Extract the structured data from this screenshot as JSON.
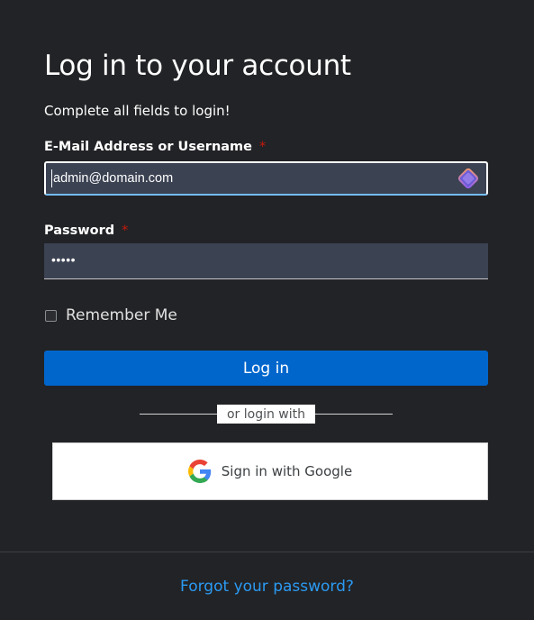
{
  "header": {
    "title": "Log in to your account",
    "subtitle": "Complete all fields to login!"
  },
  "form": {
    "email": {
      "label": "E-Mail Address or Username",
      "required_mark": "*",
      "value": "admin@domain.com"
    },
    "password": {
      "label": "Password",
      "required_mark": "*",
      "value_masked": "•••••"
    },
    "remember_me": {
      "label": "Remember Me",
      "checked": false
    },
    "submit_label": "Log in"
  },
  "social": {
    "divider_text": "or login with",
    "google_label": "Sign in with Google"
  },
  "footer": {
    "forgot_link": "Forgot your password?"
  },
  "colors": {
    "background": "#222326",
    "input_bg": "#3b4252",
    "primary": "#0066cc",
    "link": "#2b9af3",
    "required": "#c9190b"
  },
  "icons": {
    "password_manager": "password-manager-icon",
    "google": "google-icon"
  }
}
